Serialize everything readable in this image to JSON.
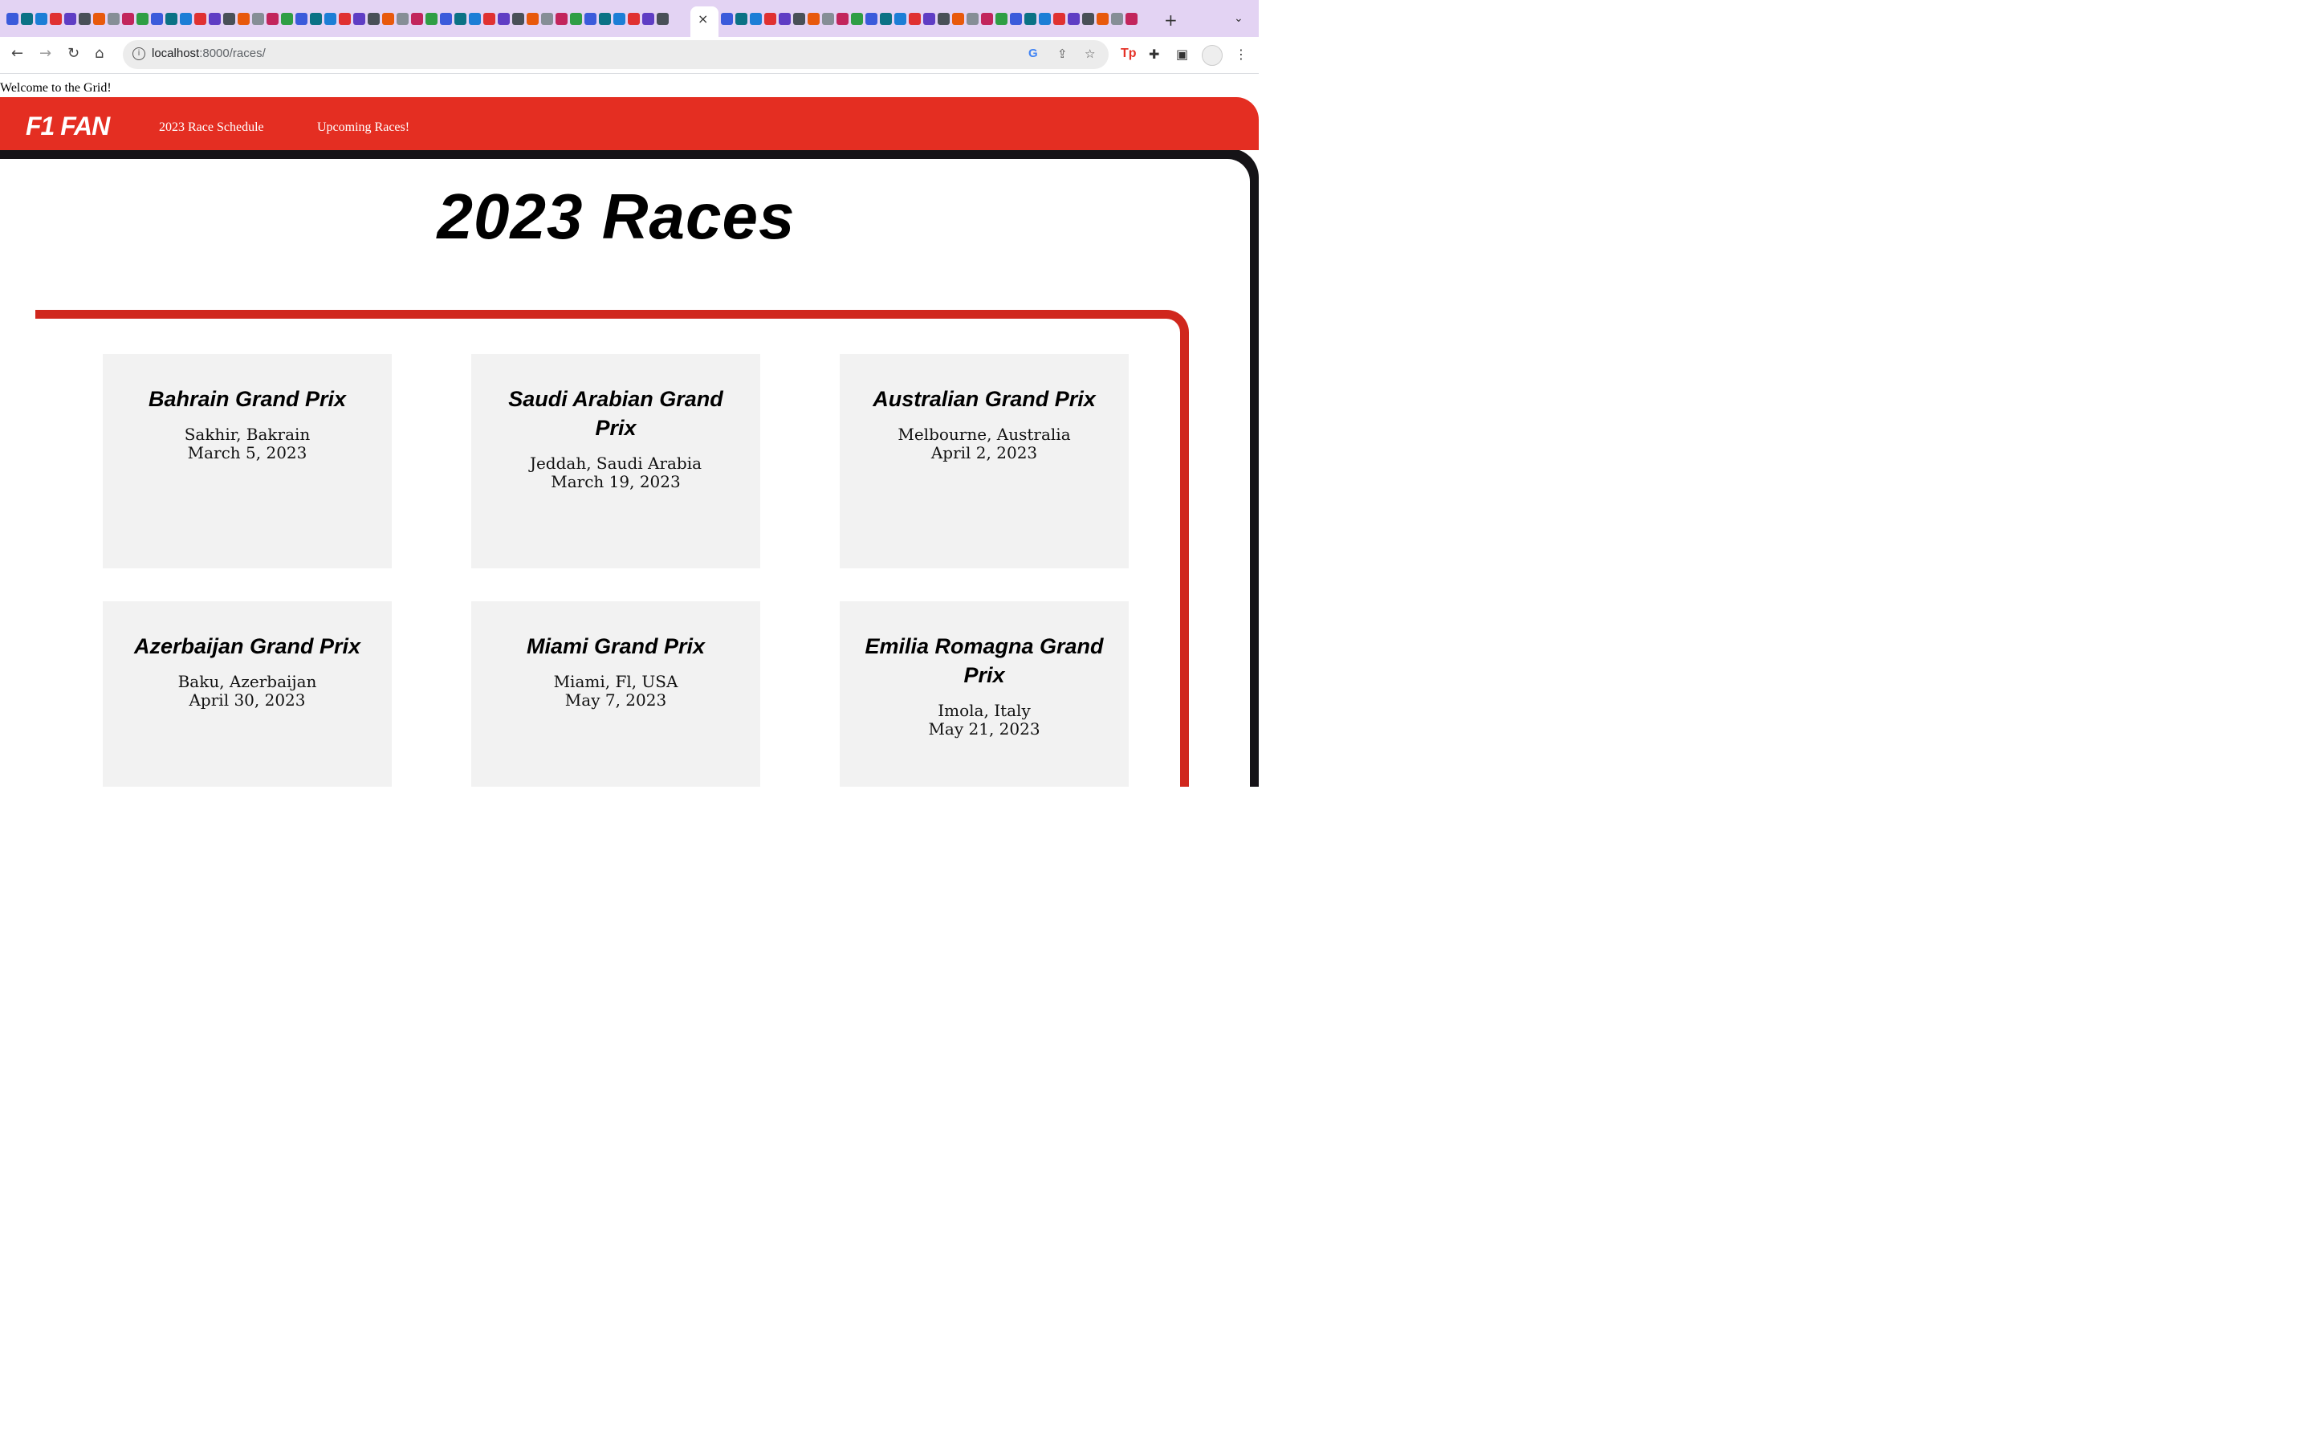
{
  "browser": {
    "tab_close": "×",
    "new_tab": "+",
    "tab_menu": "⌄",
    "url_host": "localhost",
    "url_rest": ":8000/races/",
    "profile_badge": "Tp"
  },
  "page": {
    "welcome": "Welcome to the Grid!",
    "logo": "F1 FAN",
    "nav": {
      "schedule": "2023 Race Schedule",
      "upcoming": "Upcoming Races!"
    },
    "title": "2023 Races"
  },
  "races": [
    {
      "name": "Bahrain Grand Prix",
      "location": "Sakhir, Bakrain",
      "date": "March 5, 2023"
    },
    {
      "name": "Saudi Arabian Grand Prix",
      "location": "Jeddah, Saudi Arabia",
      "date": "March 19, 2023"
    },
    {
      "name": "Australian Grand Prix",
      "location": "Melbourne, Australia",
      "date": "April 2, 2023"
    },
    {
      "name": "Azerbaijan Grand Prix",
      "location": "Baku, Azerbaijan",
      "date": "April 30, 2023"
    },
    {
      "name": "Miami Grand Prix",
      "location": "Miami, Fl, USA",
      "date": "May 7, 2023"
    },
    {
      "name": "Emilia Romagna Grand Prix",
      "location": "Imola, Italy",
      "date": "May 21, 2023"
    }
  ],
  "colors": {
    "brand_red": "#e42e22",
    "frame_red": "#d0271d",
    "frame_dark": "#151317",
    "card_bg": "#f2f2f2",
    "tabstrip": "#e3d3f3"
  }
}
